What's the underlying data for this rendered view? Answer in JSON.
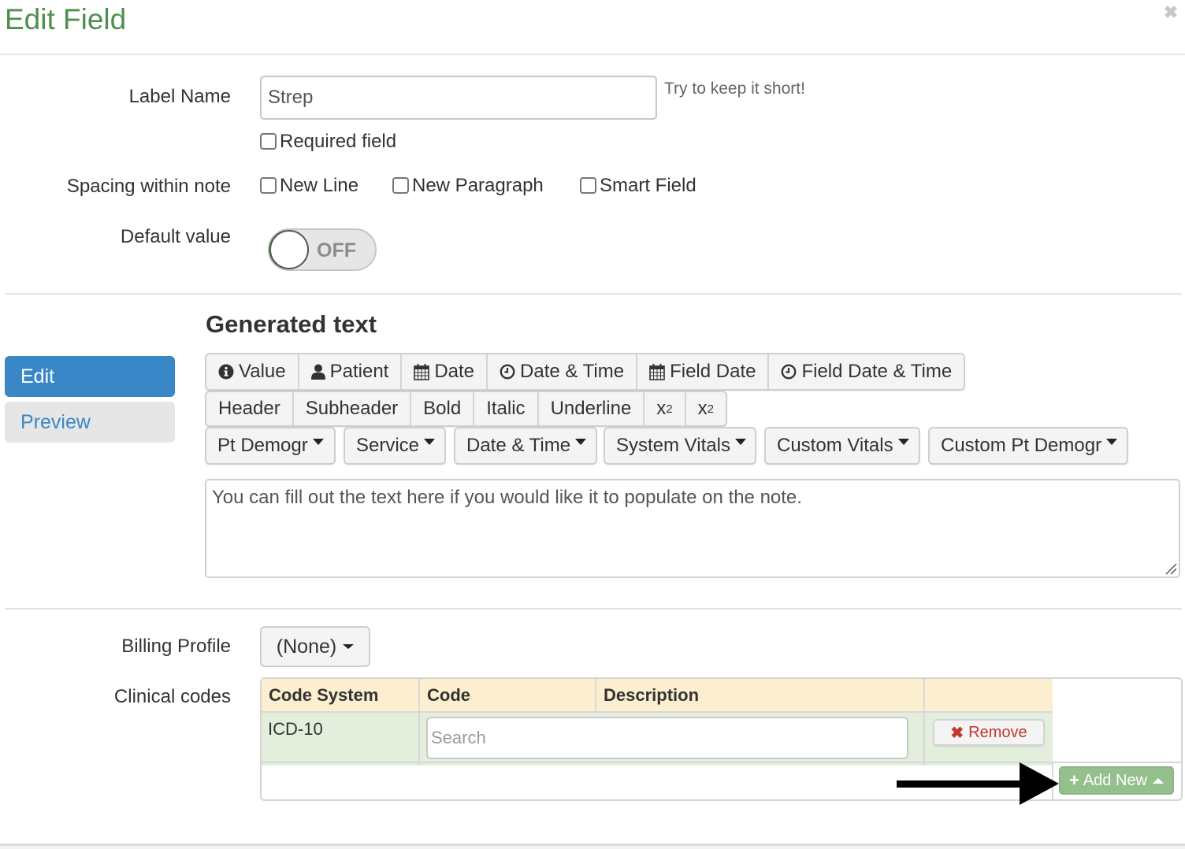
{
  "modal": {
    "title": "Edit Field",
    "close_icon": "close-icon"
  },
  "form": {
    "label_name": {
      "label": "Label Name",
      "value": "Strep",
      "hint": "Try to keep it short!"
    },
    "required": {
      "label": "Required field",
      "checked": false
    },
    "spacing": {
      "label": "Spacing within note",
      "options": [
        {
          "label": "New Line",
          "checked": false
        },
        {
          "label": "New Paragraph",
          "checked": false
        },
        {
          "label": "Smart Field",
          "checked": false
        }
      ]
    },
    "default_value": {
      "label": "Default value",
      "toggle_state": "OFF",
      "on": false
    }
  },
  "generated_text": {
    "title": "Generated text",
    "tabs": [
      {
        "label": "Edit",
        "active": true
      },
      {
        "label": "Preview",
        "active": false
      }
    ],
    "toolbar_row1": [
      {
        "label": "Value",
        "icon": "info-circle-icon"
      },
      {
        "label": "Patient",
        "icon": "user-icon"
      },
      {
        "label": "Date",
        "icon": "calendar-icon"
      },
      {
        "label": "Date & Time",
        "icon": "clock-icon"
      },
      {
        "label": "Field Date",
        "icon": "calendar-icon"
      },
      {
        "label": "Field Date & Time",
        "icon": "clock-icon"
      }
    ],
    "toolbar_row2": [
      {
        "label": "Header"
      },
      {
        "label": "Subheader"
      },
      {
        "label": "Bold"
      },
      {
        "label": "Italic"
      },
      {
        "label": "Underline"
      },
      {
        "label": "x",
        "sub": "2"
      },
      {
        "label": "x",
        "sup": "2"
      }
    ],
    "dropdowns": [
      {
        "label": "Pt Demogr"
      },
      {
        "label": "Service"
      },
      {
        "label": "Date & Time"
      },
      {
        "label": "System Vitals"
      },
      {
        "label": "Custom Vitals"
      },
      {
        "label": "Custom Pt Demogr"
      }
    ],
    "text": "You can fill out the text here if you would like it to populate on the note."
  },
  "billing": {
    "label": "Billing Profile",
    "selected": "(None)"
  },
  "clinical_codes": {
    "label": "Clinical codes",
    "columns": [
      "Code System",
      "Code",
      "Description",
      ""
    ],
    "rows": [
      {
        "code_system": "ICD-10",
        "search_placeholder": "Search",
        "search_value": "",
        "remove_label": "Remove"
      }
    ],
    "add_new_label": "Add New"
  },
  "colors": {
    "title_green": "#4e8f4e",
    "tab_active_blue": "#3a87c7",
    "table_header": "#fcefcf",
    "table_row": "#e3efdc",
    "remove_red": "#c0392b",
    "add_new_green": "#95c08e"
  }
}
